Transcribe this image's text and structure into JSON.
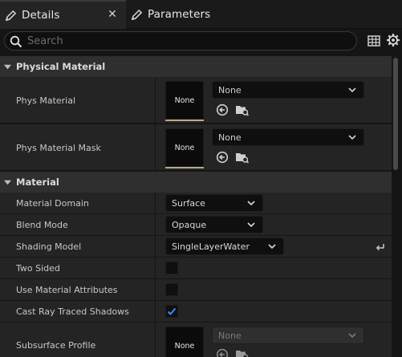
{
  "tabs": [
    {
      "label": "Details",
      "icon": "pencil-icon",
      "active": true
    },
    {
      "label": "Parameters",
      "icon": "pencil-icon",
      "active": false
    }
  ],
  "close_glyph": "✕",
  "search": {
    "placeholder": "Search",
    "value": ""
  },
  "colors": {
    "accent": "#3a8df5",
    "panel": "#242424",
    "category": "#2f2f2f",
    "thumbnail_border": "#b8a98c"
  },
  "sections": {
    "physical_material": {
      "label": "Physical Material",
      "phys_material": {
        "label": "Phys Material",
        "thumb_text": "None",
        "value": "None"
      },
      "phys_material_mask": {
        "label": "Phys Material Mask",
        "thumb_text": "None",
        "value": "None"
      }
    },
    "material": {
      "label": "Material",
      "material_domain": {
        "label": "Material Domain",
        "value": "Surface"
      },
      "blend_mode": {
        "label": "Blend Mode",
        "value": "Opaque"
      },
      "shading_model": {
        "label": "Shading Model",
        "value": "SingleLayerWater"
      },
      "two_sided": {
        "label": "Two Sided",
        "checked": false
      },
      "use_material_attributes": {
        "label": "Use Material Attributes",
        "checked": false
      },
      "cast_ray_traced_shadows": {
        "label": "Cast Ray Traced Shadows",
        "checked": true
      },
      "subsurface_profile": {
        "label": "Subsurface Profile",
        "thumb_text": "None",
        "value": "None",
        "enabled": false
      }
    }
  }
}
